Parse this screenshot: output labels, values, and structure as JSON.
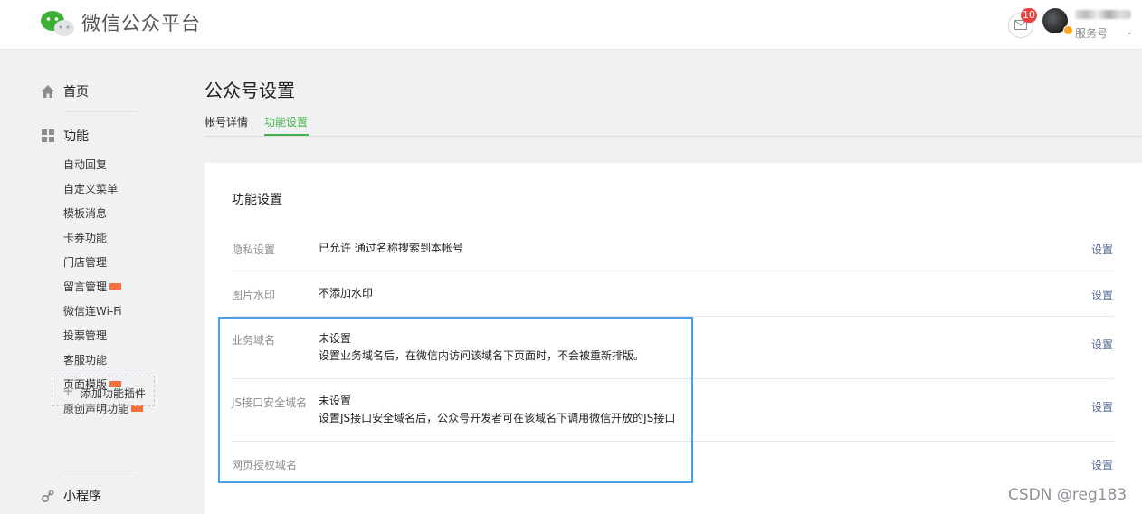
{
  "header": {
    "app_title": "微信公众平台",
    "unread_count": "10",
    "account_type": "服务号"
  },
  "sidebar": {
    "home_label": "首页",
    "function_label": "功能",
    "function_items": [
      {
        "label": "自动回复",
        "new": false
      },
      {
        "label": "自定义菜单",
        "new": false
      },
      {
        "label": "模板消息",
        "new": false
      },
      {
        "label": "卡券功能",
        "new": false
      },
      {
        "label": "门店管理",
        "new": false
      },
      {
        "label": "留言管理",
        "new": true
      },
      {
        "label": "微信连Wi-Fi",
        "new": false
      },
      {
        "label": "投票管理",
        "new": false
      },
      {
        "label": "客服功能",
        "new": false
      },
      {
        "label": "页面模版",
        "new": true
      },
      {
        "label": "原创声明功能",
        "new": true
      }
    ],
    "add_plugin_label": "添加功能插件",
    "miniprogram_label": "小程序"
  },
  "main": {
    "page_title": "公众号设置",
    "tabs": [
      {
        "label": "帐号详情",
        "active": false
      },
      {
        "label": "功能设置",
        "active": true
      }
    ],
    "section_title": "功能设置",
    "rows": [
      {
        "label": "隐私设置",
        "value": "已允许 通过名称搜索到本帐号",
        "desc": "",
        "action": "设置"
      },
      {
        "label": "图片水印",
        "value": "不添加水印",
        "desc": "",
        "action": "设置"
      },
      {
        "label": "业务域名",
        "value": "未设置",
        "desc": "设置业务域名后，在微信内访问该域名下页面时，不会被重新排版。",
        "action": "设置"
      },
      {
        "label": "JS接口安全域名",
        "value": "未设置",
        "desc": "设置JS接口安全域名后，公众号开发者可在该域名下调用微信开放的JS接口",
        "action": "设置"
      },
      {
        "label": "网页授权域名",
        "value": "",
        "desc": "",
        "action": "设置"
      }
    ]
  },
  "watermark": "CSDN @reg183",
  "colors": {
    "accent_green": "#44b549",
    "link_blue": "#576b95",
    "highlight_border": "#4b9fe8",
    "badge_red": "#e64340",
    "new_tag": "#f6703f"
  },
  "icons": {
    "logo": "wechat-logo-icon",
    "mail": "mail-icon",
    "home": "home-icon",
    "function": "grid-icon",
    "plugin": "plus-icon",
    "miniprogram": "link-icon"
  }
}
